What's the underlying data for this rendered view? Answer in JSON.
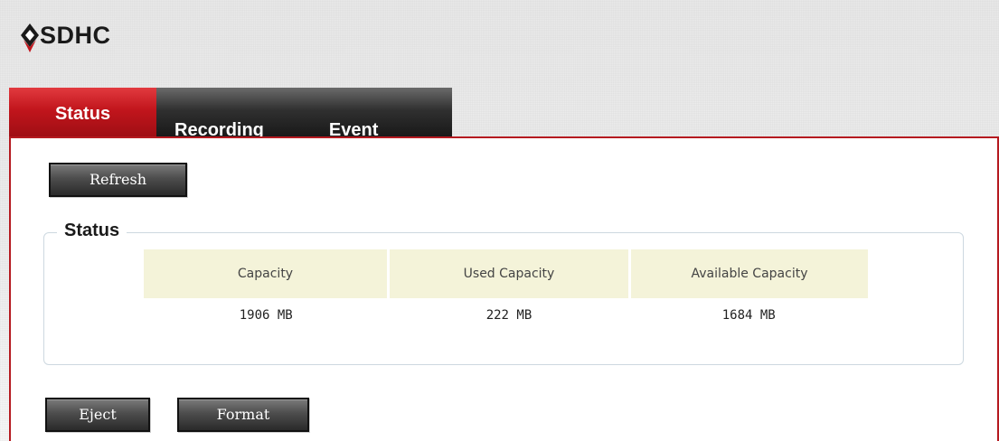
{
  "app": {
    "title": "SDHC",
    "logo_icon": "diamond-logo-icon",
    "colors": {
      "accent_red": "#c1151c",
      "tab_dark": "#303030",
      "table_header_bg": "#f4f3d9"
    }
  },
  "tabs": [
    {
      "label": "Status",
      "active": true
    },
    {
      "label": "Recording",
      "active": false
    },
    {
      "label": "Event",
      "active": false
    }
  ],
  "toolbar": {
    "refresh_label": "Refresh"
  },
  "status_section": {
    "legend": "Status",
    "columns": [
      "Capacity",
      "Used Capacity",
      "Available Capacity"
    ],
    "values": [
      "1906 MB",
      "222 MB",
      "1684 MB"
    ]
  },
  "actions": {
    "eject_label": "Eject",
    "format_label": "Format"
  }
}
